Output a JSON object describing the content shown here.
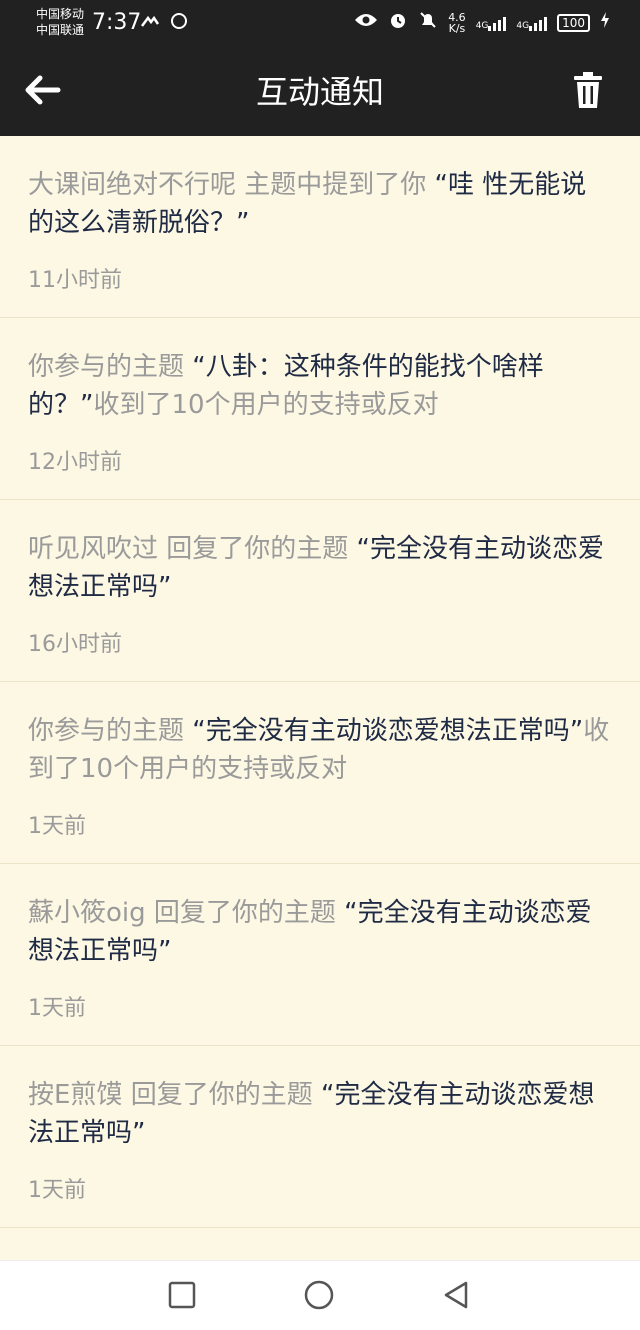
{
  "status_bar": {
    "carrier1": "中国移动",
    "carrier2": "中国联通",
    "time": "7:37",
    "net_speed_value": "4.6",
    "net_speed_unit": "K/s",
    "signal_label_1": "4G",
    "signal_label_2": "4G",
    "battery": "100"
  },
  "header": {
    "title": "互动通知"
  },
  "notifications": [
    {
      "prefix": "大课间绝对不行呢 主题中提到了你",
      "topic": "“哇 性无能说的这么清新脱俗？”",
      "suffix": "",
      "time": "11小时前"
    },
    {
      "prefix": "你参与的主题",
      "topic": "“八卦：这种条件的能找个啥样的？”",
      "suffix": "收到了10个用户的支持或反对",
      "time": "12小时前"
    },
    {
      "prefix": "听见风吹过 回复了你的主题",
      "topic": "“完全没有主动谈恋爱想法正常吗”",
      "suffix": "",
      "time": "16小时前"
    },
    {
      "prefix": "你参与的主题",
      "topic": "“完全没有主动谈恋爱想法正常吗”",
      "suffix": "收到了10个用户的支持或反对",
      "time": "1天前"
    },
    {
      "prefix": "蘇小筱oig 回复了你的主题",
      "topic": "“完全没有主动谈恋爱想法正常吗”",
      "suffix": "",
      "time": "1天前"
    },
    {
      "prefix": "按E煎馍 回复了你的主题",
      "topic": "“完全没有主动谈恋爱想法正常吗”",
      "suffix": "",
      "time": "1天前"
    }
  ],
  "colors": {
    "header_bg": "#212121",
    "list_bg": "#fdf8e4",
    "muted_text": "#9a9a9a",
    "topic_text": "#1f2a44"
  }
}
